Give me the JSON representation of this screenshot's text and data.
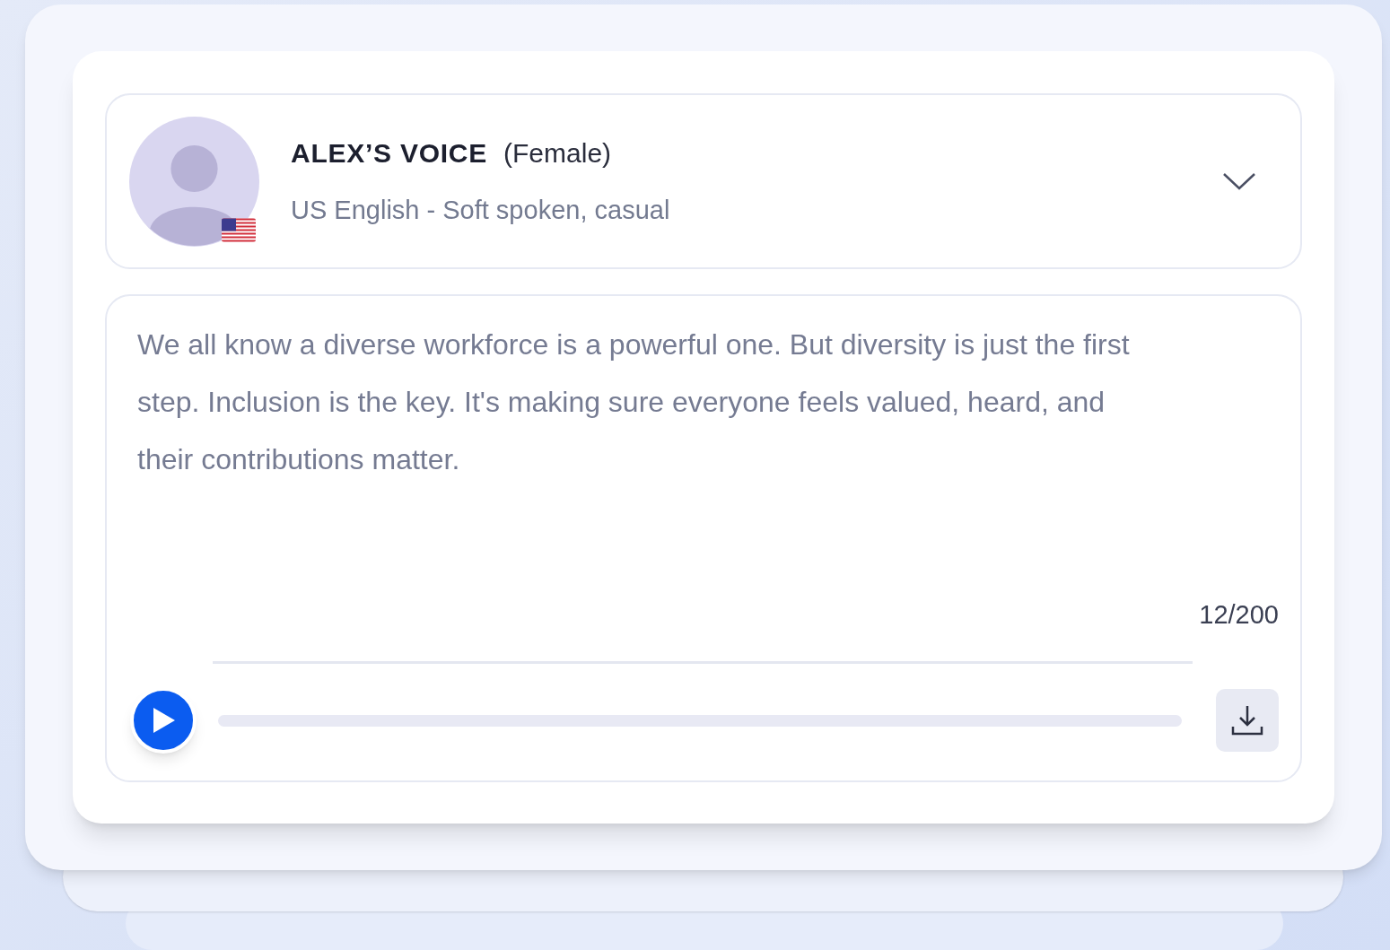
{
  "voice": {
    "name": "ALEX’S VOICE",
    "gender": "(Female)",
    "description": "US English - Soft spoken, casual",
    "expanded": false
  },
  "script": {
    "text": "We all know a diverse workforce is a powerful one. But diversity is just the first step. Inclusion is the key. It's making sure everyone feels valued, heard, and their contributions matter.",
    "counter": "12/200"
  },
  "player": {
    "playing": false
  }
}
